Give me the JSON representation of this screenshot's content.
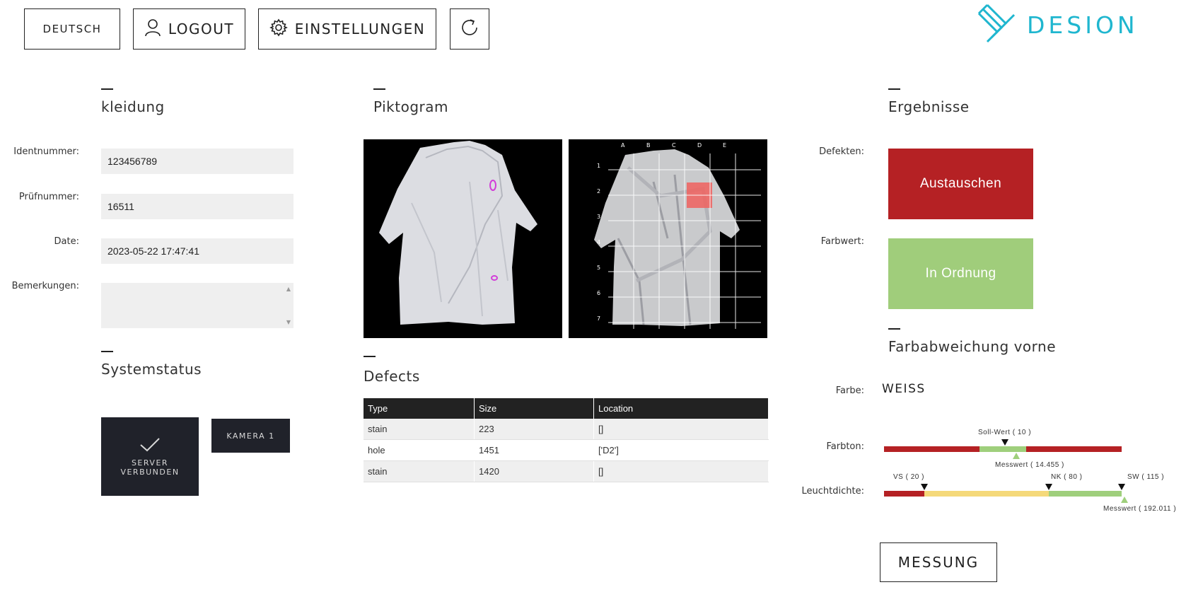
{
  "toolbar": {
    "language": "DEUTSCH",
    "logout": "LOGOUT",
    "settings": "EINSTELLUNGEN",
    "refresh_icon": "refresh-icon"
  },
  "logo": {
    "text": "DESION",
    "color": "#1fb6cf"
  },
  "kleidung": {
    "title": "kleidung",
    "fields": [
      {
        "label": "Identnummer:",
        "value": "123456789"
      },
      {
        "label": "Prüfnummer:",
        "value": "16511"
      },
      {
        "label": "Date:",
        "value": "2023-05-22 17:47:41"
      },
      {
        "label": "Bemerkungen:",
        "value": ""
      }
    ]
  },
  "systemstatus": {
    "title": "Systemstatus",
    "server_line1": "SERVER",
    "server_line2": "VERBUNDEN",
    "camera": "KAMERA 1"
  },
  "piktogram": {
    "title": "Piktogram",
    "grid_cols": [
      "A",
      "B",
      "C",
      "D",
      "E"
    ],
    "grid_rows": [
      "1",
      "2",
      "3",
      "4",
      "5",
      "6",
      "7"
    ],
    "highlight_cell": "D2"
  },
  "defects": {
    "title": "Defects",
    "columns": [
      "Type",
      "Size",
      "Location"
    ],
    "rows": [
      [
        "stain",
        "223",
        "[]"
      ],
      [
        "hole",
        "1451",
        "['D2']"
      ],
      [
        "stain",
        "1420",
        "[]"
      ]
    ]
  },
  "ergebnisse": {
    "title": "Ergebnisse",
    "defekten_label": "Defekten:",
    "defekten_value": "Austauschen",
    "defekten_color": "#b52124",
    "farbwert_label": "Farbwert:",
    "farbwert_value": "In Ordnung",
    "farbwert_color": "#a0cd7b"
  },
  "farbabweichung": {
    "title": "Farbabweichung vorne",
    "farbe_label": "Farbe:",
    "farbe_value": "WEISS",
    "farbton_label": "Farbton:",
    "farbton_soll": "Soll-Wert ( 10 )",
    "farbton_mess": "Messwert ( 14.455 )",
    "leucht_label": "Leuchtdichte:",
    "leucht_vs": "VS ( 20 )",
    "leucht_nk": "NK ( 80 )",
    "leucht_sw": "SW ( 115 )",
    "leucht_mess": "Messwert ( 192.011 )",
    "colors": {
      "red": "#b52124",
      "green": "#9fcf7c",
      "yellow": "#f5d97a"
    }
  },
  "messung": "MESSUNG"
}
